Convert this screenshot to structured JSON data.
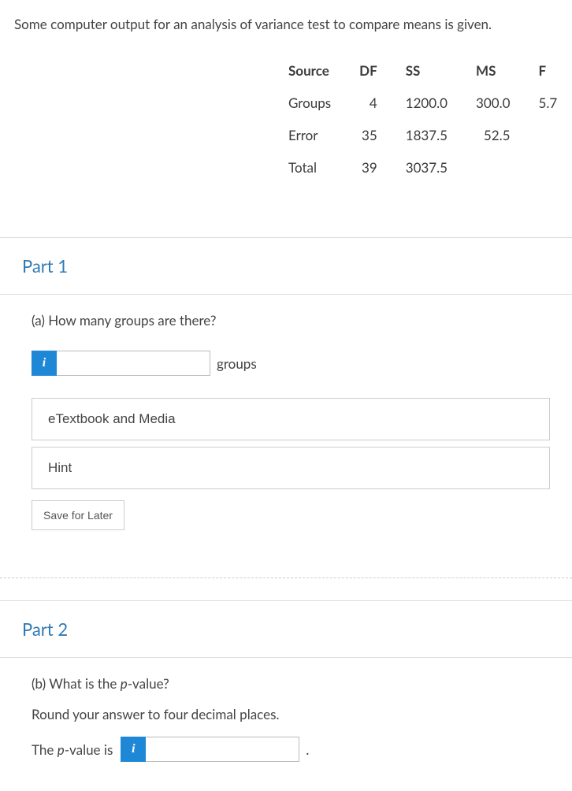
{
  "intro": "Some computer output for an analysis of variance test to compare means is given.",
  "table": {
    "headers": {
      "source": "Source",
      "df": "DF",
      "ss": "SS",
      "ms": "MS",
      "f": "F"
    },
    "rows": [
      {
        "source": "Groups",
        "df": "4",
        "ss": "1200.0",
        "ms": "300.0",
        "f": "5.7"
      },
      {
        "source": "Error",
        "df": "35",
        "ss": "1837.5",
        "ms": "52.5",
        "f": ""
      },
      {
        "source": "Total",
        "df": "39",
        "ss": "3037.5",
        "ms": "",
        "f": ""
      }
    ]
  },
  "part1": {
    "title": "Part 1",
    "question": "(a) How many groups are there?",
    "info_glyph": "i",
    "unit": "groups",
    "etextbook_btn": "eTextbook and Media",
    "hint_btn": "Hint",
    "save_btn": "Save for Later"
  },
  "part2": {
    "title": "Part 2",
    "question_prefix": "(b) What is the ",
    "question_pvar": "p",
    "question_suffix": "-value?",
    "instruction": "Round your answer to four decimal places.",
    "answer_prefix": "The ",
    "answer_pvar": "p",
    "answer_suffix": "-value is",
    "info_glyph": "i",
    "period": "."
  }
}
